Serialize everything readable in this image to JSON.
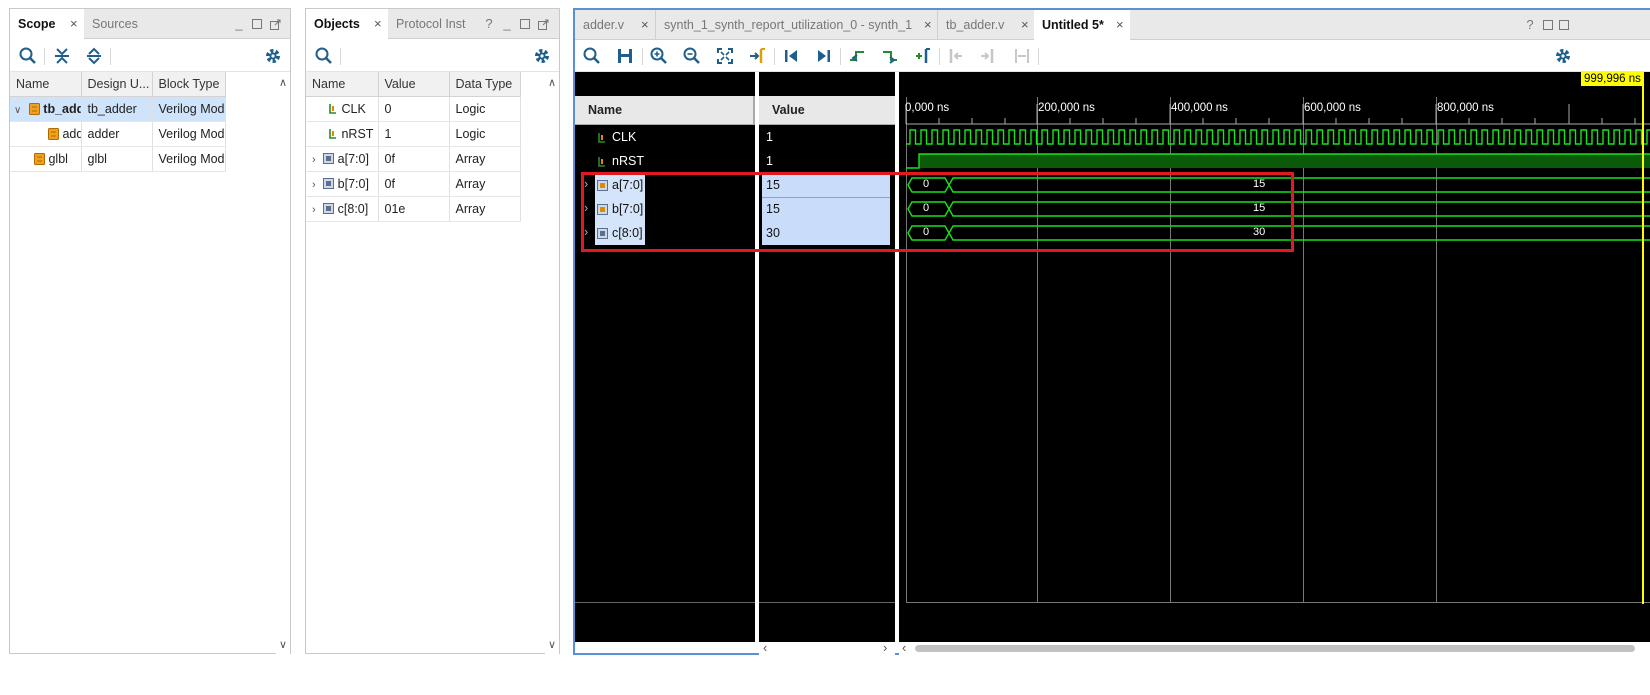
{
  "scope_panel": {
    "tabs": [
      "Scope",
      "Sources"
    ],
    "columns": [
      "Name",
      "Design U...",
      "Block Type"
    ],
    "rows": [
      {
        "name": "tb_adder",
        "design_unit": "tb_adder",
        "block_type": "Verilog Module",
        "selected": true,
        "expanded": true
      },
      {
        "name": "adder",
        "design_unit": "adder",
        "block_type": "Verilog Module",
        "selected": false,
        "expanded": false
      },
      {
        "name": "glbl",
        "design_unit": "glbl",
        "block_type": "Verilog Module",
        "selected": false,
        "expanded": false
      }
    ]
  },
  "objects_panel": {
    "tabs": [
      "Objects",
      "Protocol Inst"
    ],
    "help": "?",
    "columns": [
      "Name",
      "Value",
      "Data Type"
    ],
    "rows": [
      {
        "name": "CLK",
        "value": "0",
        "type": "Logic",
        "icon": "logic-signal-icon"
      },
      {
        "name": "nRST",
        "value": "1",
        "type": "Logic",
        "icon": "logic-signal-icon"
      },
      {
        "name": "a[7:0]",
        "value": "0f",
        "type": "Array",
        "icon": "bus-signal-icon"
      },
      {
        "name": "b[7:0]",
        "value": "0f",
        "type": "Array",
        "icon": "bus-signal-icon"
      },
      {
        "name": "c[8:0]",
        "value": "01e",
        "type": "Array",
        "icon": "bus-signal-icon"
      }
    ]
  },
  "wave_panel": {
    "tabs": [
      "adder.v",
      "synth_1_synth_report_utilization_0 - synth_1",
      "tb_adder.v",
      "Untitled 5*"
    ],
    "help": "?",
    "cursor_time": "999,996 ns",
    "name_header": "Name",
    "value_header": "Value",
    "time_labels": [
      "0,000 ns",
      "200,000 ns",
      "400,000 ns",
      "600,000 ns",
      "800,000 ns"
    ],
    "signals": [
      {
        "name": "CLK",
        "value": "1",
        "kind": "clock"
      },
      {
        "name": "nRST",
        "value": "1",
        "kind": "logic"
      },
      {
        "name": "a[7:0]",
        "value": "15",
        "kind": "bus",
        "initial": "0",
        "final": "15"
      },
      {
        "name": "b[7:0]",
        "value": "15",
        "kind": "bus",
        "initial": "0",
        "final": "15"
      },
      {
        "name": "c[8:0]",
        "value": "30",
        "kind": "bus",
        "initial": "0",
        "final": "30"
      }
    ],
    "wave_color": "#19e31a",
    "cursor_color": "#ffff00",
    "highlight_color": "#e11a22"
  }
}
